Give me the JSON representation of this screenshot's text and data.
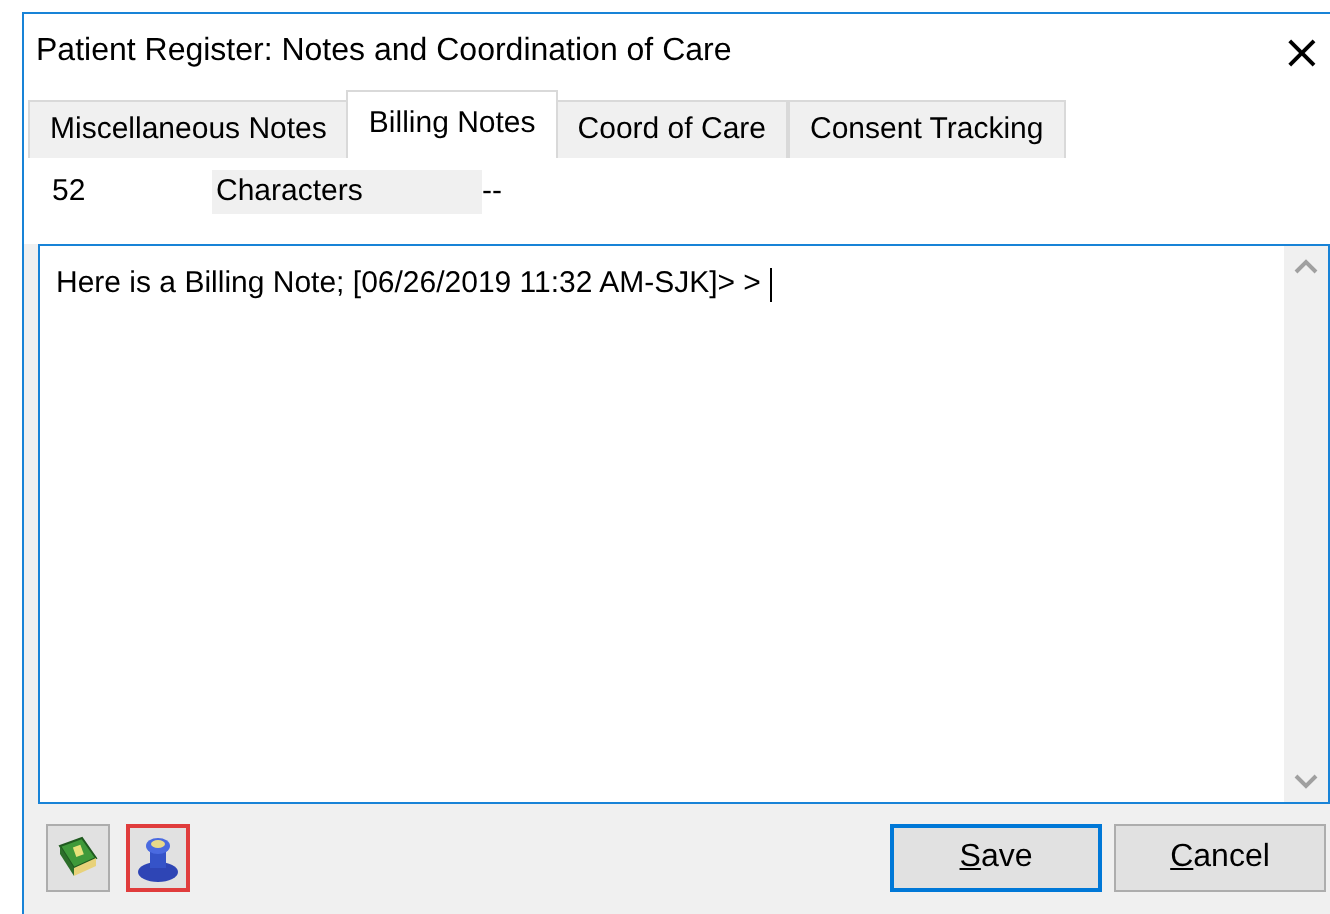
{
  "window": {
    "title": "Patient Register: Notes and Coordination of Care",
    "close": "×"
  },
  "tabs": [
    {
      "label": "Miscellaneous Notes",
      "selected": false
    },
    {
      "label": "Billing Notes",
      "selected": true
    },
    {
      "label": "Coord of Care",
      "selected": false
    },
    {
      "label": "Consent Tracking",
      "selected": false
    }
  ],
  "info": {
    "count": "52",
    "label": "Characters",
    "value": "--"
  },
  "note": {
    "value": "Here is a Billing Note; [06/26/2019 11:32 AM-SJK]> > "
  },
  "tools": [
    {
      "kind": "book",
      "selected": false
    },
    {
      "kind": "stamp",
      "selected": true
    }
  ],
  "buttons": [
    {
      "label": "Save",
      "access_key_underlined": true,
      "default": true
    },
    {
      "label": "Cancel",
      "access_key_underlined": true,
      "default": false
    }
  ]
}
